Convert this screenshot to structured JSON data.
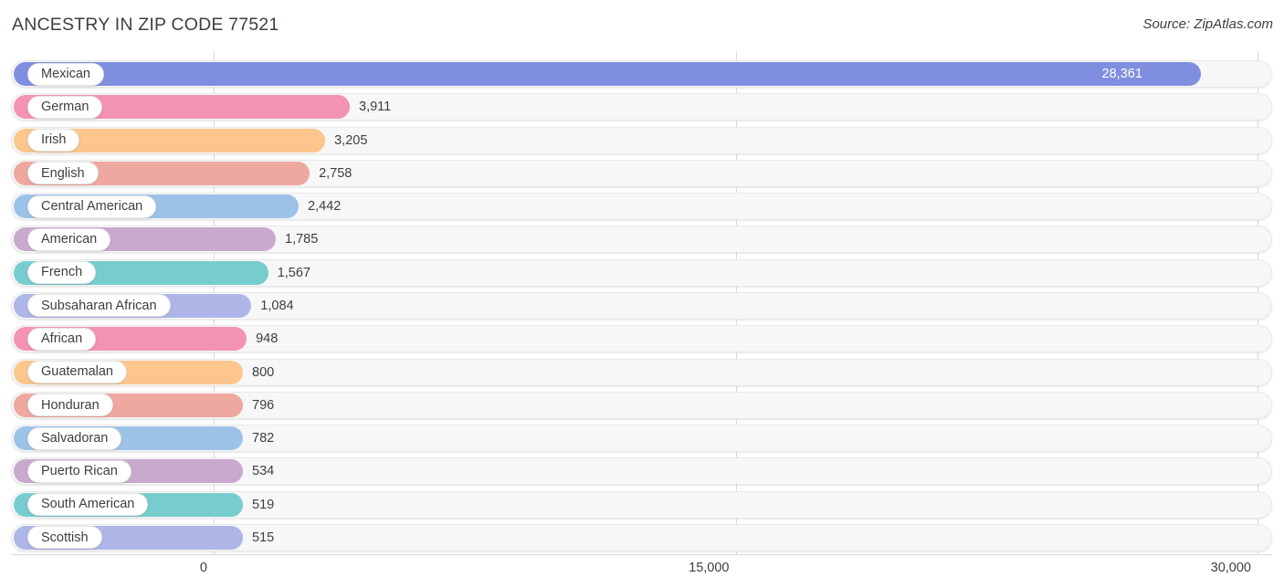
{
  "header": {
    "title": "ANCESTRY IN ZIP CODE 77521",
    "source": "Source: ZipAtlas.com"
  },
  "chart_data": {
    "type": "bar",
    "orientation": "horizontal",
    "title": "ANCESTRY IN ZIP CODE 77521",
    "xlabel": "",
    "ylabel": "",
    "xlim": [
      0,
      30000
    ],
    "xticks": [
      0,
      15000,
      30000
    ],
    "xtick_labels": [
      "0",
      "15,000",
      "30,000"
    ],
    "grid": true,
    "legend": "none",
    "categories": [
      "Mexican",
      "German",
      "Irish",
      "English",
      "Central American",
      "American",
      "French",
      "Subsaharan African",
      "African",
      "Guatemalan",
      "Honduran",
      "Salvadoran",
      "Puerto Rican",
      "South American",
      "Scottish"
    ],
    "values": [
      28361,
      3911,
      3205,
      2758,
      2442,
      1785,
      1567,
      1084,
      948,
      800,
      796,
      782,
      534,
      519,
      515
    ],
    "value_labels": [
      "28,361",
      "3,911",
      "3,205",
      "2,758",
      "2,442",
      "1,785",
      "1,567",
      "1,084",
      "948",
      "800",
      "796",
      "782",
      "534",
      "519",
      "515"
    ],
    "colors": [
      "#7f8ede",
      "#f492b4",
      "#fcc68d",
      "#eea89f",
      "#9dc2e8",
      "#c9a9cd",
      "#77cdcd",
      "#aeb6e8",
      "#f492b4",
      "#fcc68d",
      "#eea89f",
      "#9dc2e8",
      "#c9a9cd",
      "#77cdcd",
      "#aeb6e8"
    ]
  },
  "colors": {
    "track_fill": "#f7f7f7",
    "track_border": "#e8e8e8",
    "gridline": "#d9d9d9",
    "text": "#3c4043",
    "value_inside": "#ffffff"
  }
}
